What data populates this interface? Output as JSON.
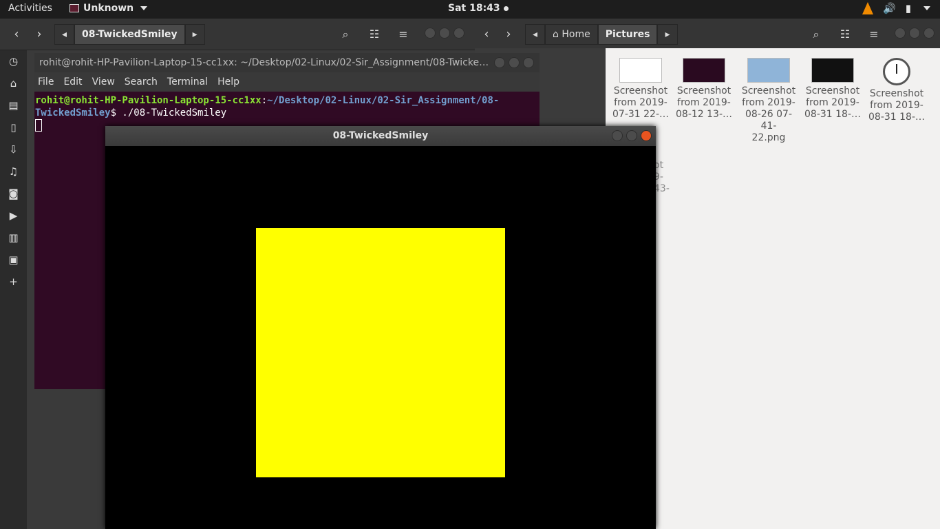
{
  "topbar": {
    "activities": "Activities",
    "app_name": "Unknown",
    "clock": "Sat 18:43"
  },
  "file_manager_left": {
    "path_current": "08-TwickedSmiley"
  },
  "file_manager_right": {
    "path_home": "Home",
    "path_current": "Pictures",
    "files": [
      {
        "line1": "Screenshot",
        "line2": "from 2019-",
        "line3": "07-31 22-…"
      },
      {
        "line1": "Screenshot",
        "line2": "from 2019-",
        "line3": "08-12 13-…"
      },
      {
        "line1": "Screenshot",
        "line2": "from 2019-",
        "line3": "08-26 07-41-",
        "line4": "22.png"
      },
      {
        "line1": "Screenshot",
        "line2": "from 2019-",
        "line3": "08-31 18-…"
      },
      {
        "line1": "Screenshot",
        "line2": "from 2019-",
        "line3": "08-31 18-…"
      }
    ],
    "ghost_text": [
      "ot",
      "9-",
      "43-"
    ]
  },
  "terminal": {
    "title": "rohit@rohit-HP-Pavilion-Laptop-15-cc1xx: ~/Desktop/02-Linux/02-Sir_Assignment/08-Twicke…",
    "menu": [
      "File",
      "Edit",
      "View",
      "Search",
      "Terminal",
      "Help"
    ],
    "prompt_user": "rohit@rohit-HP-Pavilion-Laptop-15-cc1xx",
    "prompt_path_a": "~/Desktop/02-Linux/02-Sir_Assignment/08-",
    "prompt_path_b": "TwickedSmiley",
    "command": "$ ./08-TwickedSmiley"
  },
  "gl_window": {
    "title": "08-TwickedSmiley",
    "square_color": "#ffff00"
  }
}
